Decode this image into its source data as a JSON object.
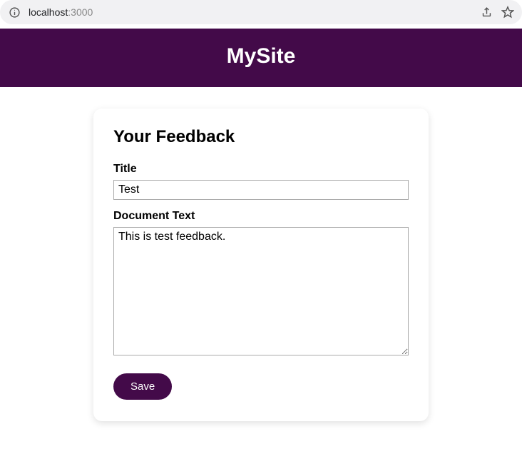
{
  "browser": {
    "url_host": "localhost",
    "url_port": ":3000"
  },
  "header": {
    "site_title": "MySite"
  },
  "card": {
    "heading": "Your Feedback",
    "title_label": "Title",
    "title_value": "Test",
    "body_label": "Document Text",
    "body_value": "This is test feedback.",
    "save_label": "Save"
  }
}
